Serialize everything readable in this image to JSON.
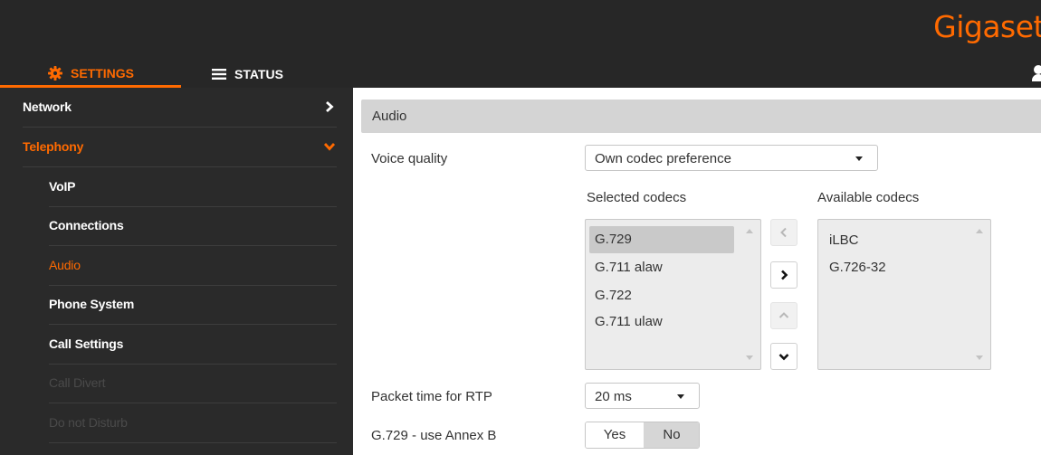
{
  "header": {
    "logo": "Gigaset",
    "tabs": [
      {
        "label": "SETTINGS",
        "icon": "gear-icon",
        "active": true
      },
      {
        "label": "STATUS",
        "icon": "menu-icon",
        "active": false
      }
    ]
  },
  "sidebar": {
    "items": [
      {
        "label": "Network",
        "state": "normal",
        "chevron": "right"
      },
      {
        "label": "Telephony",
        "state": "open",
        "chevron": "down"
      },
      {
        "label": "VoIP",
        "state": "normal"
      },
      {
        "label": "Connections",
        "state": "normal"
      },
      {
        "label": "Audio",
        "state": "active"
      },
      {
        "label": "Phone System",
        "state": "normal"
      },
      {
        "label": "Call Settings",
        "state": "normal"
      },
      {
        "label": "Call Divert",
        "state": "disabled"
      },
      {
        "label": "Do not Disturb",
        "state": "disabled"
      }
    ]
  },
  "main": {
    "section_title": "Audio",
    "voice_quality": {
      "label": "Voice quality",
      "value": "Own codec preference"
    },
    "selected_codecs": {
      "label": "Selected codecs",
      "items": [
        "G.729",
        "G.711 alaw",
        "G.722",
        "G.711 ulaw"
      ],
      "selected": "G.729"
    },
    "available_codecs": {
      "label": "Available codecs",
      "items": [
        "iLBC",
        "G.726-32"
      ]
    },
    "packet_time": {
      "label": "Packet time for RTP",
      "value": "20 ms"
    },
    "annex_b": {
      "label": "G.729 - use Annex B",
      "yes": "Yes",
      "no": "No",
      "selected": "No"
    }
  },
  "colors": {
    "accent": "#ff6a00",
    "header_bg": "#272727",
    "sidebar_bg": "#2a2a2a",
    "section_bg": "#d4d4d4"
  }
}
